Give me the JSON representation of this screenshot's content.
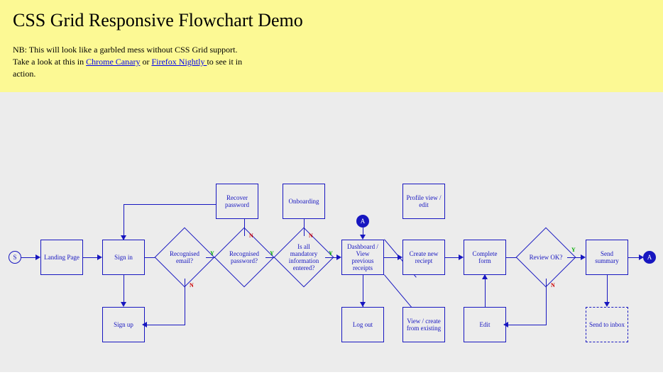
{
  "header": {
    "title": "CSS Grid Responsive Flowchart Demo",
    "note_prefix": "NB: This will look like a garbled mess without CSS Grid support. Take a look at this in ",
    "link1": "Chrome Canary",
    "note_mid": " or ",
    "link2": "Firefox Nightly ",
    "note_suffix": "to see it in action."
  },
  "nodes": {
    "start": "S",
    "landing": "Landing Page",
    "signin": "Sign in",
    "signup": "Sign up",
    "rec_email": "Recognised email?",
    "rec_pwd": "Recognised password?",
    "recover": "Recover password",
    "onboarding": "Onboarding",
    "mandatory": "Is all mandatory information entered?",
    "conn_a1": "A",
    "dashboard": "Dashboard / View previous receipts",
    "profile": "Profile view / edit",
    "logout": "Log out",
    "create_new": "Create new reciept",
    "view_create": "View / create from existing",
    "complete": "Complete form",
    "edit": "Edit",
    "review": "Review OK?",
    "send_summary": "Send summary",
    "send_inbox": "Send to inbox",
    "conn_a2": "A"
  },
  "labels": {
    "y": "Y",
    "n": "N"
  }
}
